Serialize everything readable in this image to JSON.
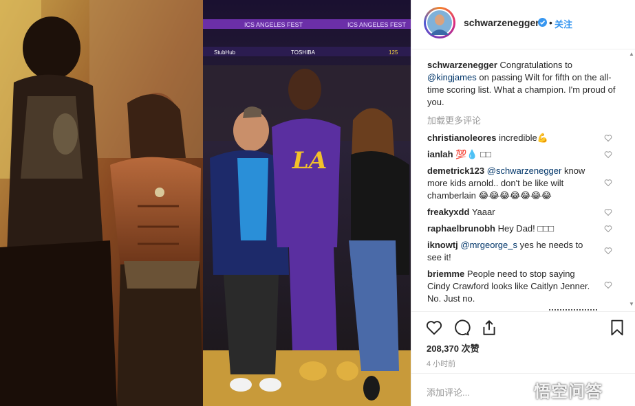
{
  "post": {
    "username": "schwarzenegger",
    "follow_label": "关注",
    "dot": "•"
  },
  "caption": {
    "username": "schwarzenegger",
    "text_1": "Congratulations to",
    "mention": "@kingjames",
    "text_2": "on passing Wilt for fifth on the all-time scoring list. What a champion. I'm proud of you."
  },
  "load_more": "加载更多评论",
  "comments": [
    {
      "user": "christianoleores",
      "mention": "",
      "text": "incredible💪"
    },
    {
      "user": "ianlah",
      "mention": "",
      "text": "💯💧 □□"
    },
    {
      "user": "demetrick123",
      "mention": "@schwarzenegger",
      "text": "know more kids arnold.. don't be like wilt chamberlain 😂😂😂😂😂😂😂"
    },
    {
      "user": "freakyxdd",
      "mention": "",
      "text": "Yaaar"
    },
    {
      "user": "raphaelbrunobh",
      "mention": "",
      "text": "Hey Dad! □□□"
    },
    {
      "user": "iknowtj",
      "mention": "@mrgeorge_s",
      "text": "yes he needs to see it!"
    },
    {
      "user": "briemme",
      "mention": "",
      "text": "People need to stop saying Cindy Crawford looks like Caitlyn Jenner. No. Just no."
    }
  ],
  "likes": "208,370 次赞",
  "time_ago": "4 小时前",
  "add_comment_placeholder": "添加评论...",
  "watermark": "悟空问答",
  "arena_signage": {
    "top_banner": "ICS ANGELES FEST",
    "stubhub": "StubHub",
    "toshiba": "TOSHIBA",
    "scoreboard": "125",
    "jersey": "LA"
  },
  "icons": [
    "heart-icon",
    "comment-icon",
    "share-icon",
    "bookmark-icon",
    "verified-icon",
    "small-heart-icon"
  ],
  "colors": {
    "link": "#003569",
    "follow": "#3897f0",
    "verified": "#3897f0",
    "muted": "#999999"
  }
}
